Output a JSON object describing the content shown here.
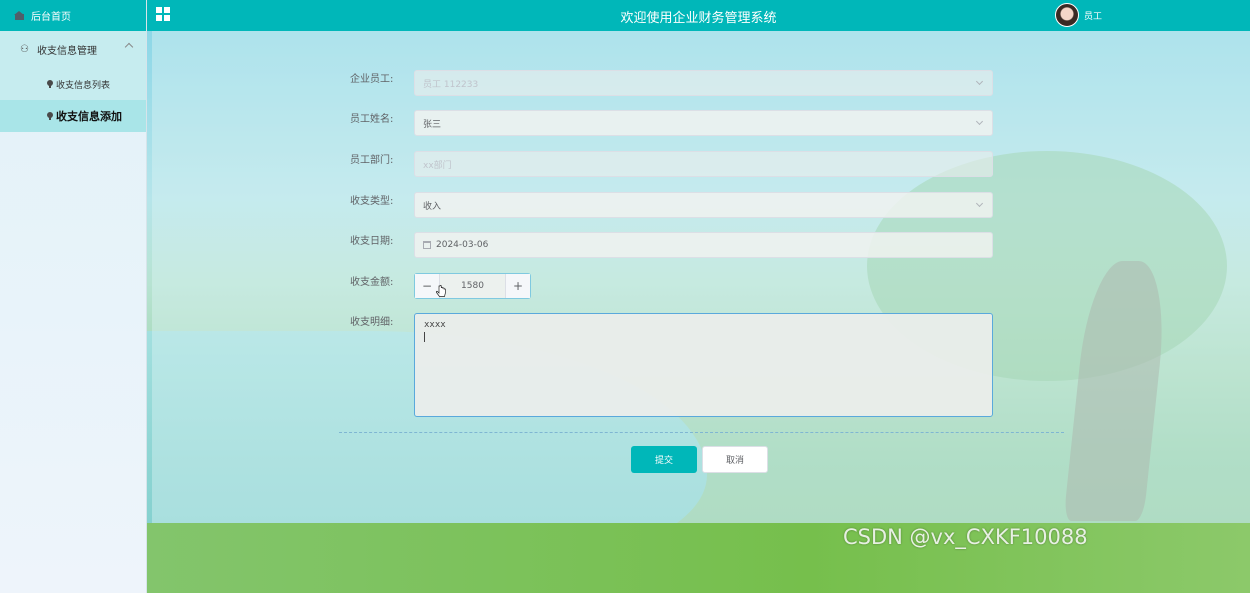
{
  "topbar": {
    "title": "欢迎使用企业财务管理系统",
    "user_name": "员工"
  },
  "sidebar": {
    "home": "后台首页",
    "group": "收支信息管理",
    "items": [
      {
        "label": "收支信息列表",
        "active": false
      },
      {
        "label": "收支信息添加",
        "active": true
      }
    ]
  },
  "form": {
    "employee": {
      "label": "企业员工:",
      "value": "员工 112233"
    },
    "name": {
      "label": "员工姓名:",
      "value": "张三"
    },
    "department": {
      "label": "员工部门:",
      "placeholder": "xx部门"
    },
    "type": {
      "label": "收支类型:",
      "value": "收入"
    },
    "date": {
      "label": "收支日期:",
      "value": "2024-03-06"
    },
    "amount": {
      "label": "收支金额:",
      "value": "1580",
      "minus": "−",
      "plus": "+"
    },
    "detail": {
      "label": "收支明细:",
      "value": "xxxx"
    }
  },
  "buttons": {
    "submit": "提交",
    "cancel": "取消"
  },
  "watermark": "CSDN @vx_CXKF10088",
  "colors": {
    "accent": "#00b7b9",
    "sidebar_menu": "#c6ecef"
  }
}
